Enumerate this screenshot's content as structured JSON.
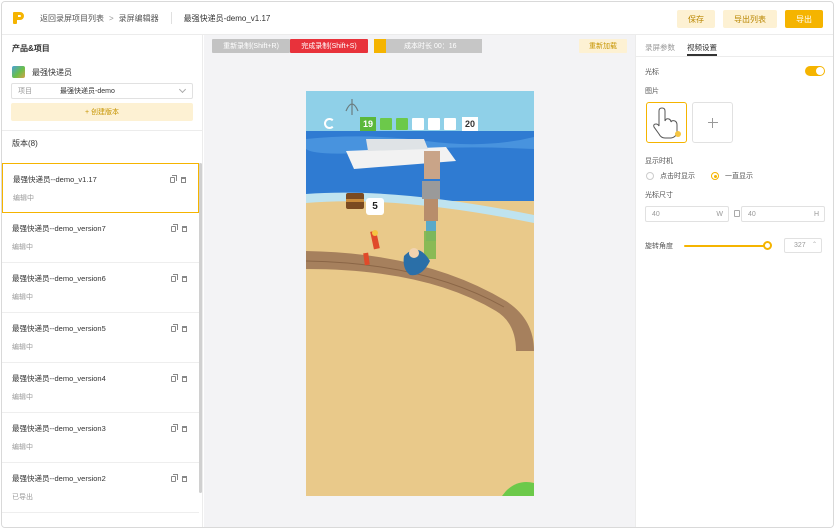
{
  "topbar": {
    "breadcrumb_back": "返回录屏项目列表",
    "breadcrumb_current": "录屏编辑器",
    "document_title": "最强快递员-demo_v1.17",
    "save_label": "保存",
    "export_list_label": "导出列表",
    "export_label": "导出"
  },
  "left": {
    "section_title": "产品&项目",
    "product_name": "最强快递员",
    "project_label": "项目",
    "project_value": "最强快递员-demo",
    "create_version_label": "+ 创建版本",
    "versions_title": "版本(8)",
    "versions": [
      {
        "name": "最强快递员--demo_v1.17",
        "status": "编辑中"
      },
      {
        "name": "最强快递员--demo_version7",
        "status": "编辑中"
      },
      {
        "name": "最强快递员--demo_version6",
        "status": "编辑中"
      },
      {
        "name": "最强快递员--demo_version5",
        "status": "编辑中"
      },
      {
        "name": "最强快递员--demo_version4",
        "status": "编辑中"
      },
      {
        "name": "最强快递员--demo_version3",
        "status": "编辑中"
      },
      {
        "name": "最强快递员--demo_version2",
        "status": "已导出"
      }
    ]
  },
  "center": {
    "rerecord_label": "重新录制(Shift+R)",
    "finish_label": "完成录制(Shift+S)",
    "duration_label": "成本时长 00：16",
    "reload_label": "重新加载",
    "game": {
      "level_current": "19",
      "level_next": "20",
      "chest_count": "5"
    }
  },
  "right": {
    "tab_params": "录屏参数",
    "tab_video": "视频设置",
    "cursor_label": "光标",
    "image_label": "图片",
    "show_timing_label": "显示时机",
    "show_on_click": "点击时显示",
    "show_always": "一直显示",
    "cursor_size_label": "光标尺寸",
    "width_value": "40",
    "width_unit": "W",
    "height_value": "40",
    "height_unit": "H",
    "rotation_label": "旋转角度",
    "rotation_value": "327",
    "rotation_degrees": 327,
    "accent_color": "#f5b400"
  }
}
